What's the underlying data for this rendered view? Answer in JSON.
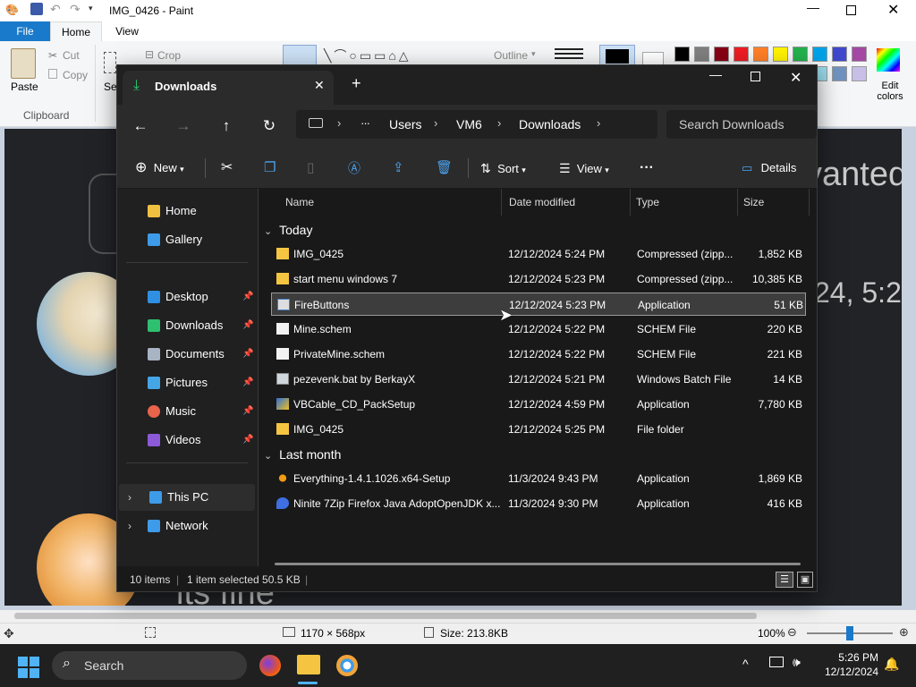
{
  "paint": {
    "title": "IMG_0426 - Paint",
    "tabs": {
      "file": "File",
      "home": "Home",
      "view": "View"
    },
    "ribbon": {
      "paste": "Paste",
      "cut": "Cut",
      "copy": "Copy",
      "crop": "Crop",
      "outline": "Outline",
      "clipboard_group": "Clipboard",
      "select_partial": "Se",
      "edit_colors": "Edit colors"
    },
    "canvas_text": {
      "wanted": "vanted",
      "time": "24, 5:2",
      "bottom": "its fine"
    },
    "status": {
      "dimensions": "1170 × 568px",
      "size": "Size: 213.8KB",
      "zoom": "100%",
      "zoom_level": 0.5
    },
    "palette": [
      "#000000",
      "#7f7f7f",
      "#880015",
      "#ed1c24",
      "#ff7f27",
      "#fff200",
      "#22b14c",
      "#00a2e8",
      "#3f48cc",
      "#a349a4",
      "#ffffff",
      "#c3c3c3",
      "#b97a57",
      "#ffaec9",
      "#ffc90e",
      "#efe4b0",
      "#b5e61d",
      "#99d9ea",
      "#7092be",
      "#c8bfe7"
    ]
  },
  "explorer": {
    "tab_title": "Downloads",
    "new_tab": "+",
    "breadcrumb": [
      "Users",
      "VM6",
      "Downloads"
    ],
    "breadcrumb_more": "···",
    "search_placeholder": "Search Downloads",
    "commands": {
      "new": "New",
      "sort": "Sort",
      "view": "View",
      "more": "···",
      "details": "Details"
    },
    "sidebar": {
      "home": "Home",
      "gallery": "Gallery",
      "desktop": "Desktop",
      "downloads": "Downloads",
      "documents": "Documents",
      "pictures": "Pictures",
      "music": "Music",
      "videos": "Videos",
      "this_pc": "This PC",
      "network": "Network"
    },
    "columns": {
      "name": "Name",
      "date": "Date modified",
      "type": "Type",
      "size": "Size"
    },
    "groups": {
      "today": "Today",
      "last_month": "Last month"
    },
    "today_files": [
      {
        "name": "IMG_0425",
        "date": "12/12/2024 5:24 PM",
        "type": "Compressed (zipp...",
        "size": "1,852 KB",
        "icon": "zip-folder-icon"
      },
      {
        "name": "start menu windows 7",
        "date": "12/12/2024 5:23 PM",
        "type": "Compressed (zipp...",
        "size": "10,385 KB",
        "icon": "zip-folder-icon"
      },
      {
        "name": "FireButtons",
        "date": "12/12/2024 5:23 PM",
        "type": "Application",
        "size": "51 KB",
        "icon": "application-icon"
      },
      {
        "name": "Mine.schem",
        "date": "12/12/2024 5:22 PM",
        "type": "SCHEM File",
        "size": "220 KB",
        "icon": "file-icon"
      },
      {
        "name": "PrivateMine.schem",
        "date": "12/12/2024 5:22 PM",
        "type": "SCHEM File",
        "size": "221 KB",
        "icon": "file-icon"
      },
      {
        "name": "pezevenk.bat by BerkayX",
        "date": "12/12/2024 5:21 PM",
        "type": "Windows Batch File",
        "size": "14 KB",
        "icon": "batch-file-icon"
      },
      {
        "name": "VBCable_CD_PackSetup",
        "date": "12/12/2024 4:59 PM",
        "type": "Application",
        "size": "7,780 KB",
        "icon": "setup-icon"
      },
      {
        "name": "IMG_0425",
        "date": "12/12/2024 5:25 PM",
        "type": "File folder",
        "size": "",
        "icon": "folder-icon"
      }
    ],
    "last_month_files": [
      {
        "name": "Everything-1.4.1.1026.x64-Setup",
        "date": "11/3/2024 9:43 PM",
        "type": "Application",
        "size": "1,869 KB",
        "icon": "search-app-icon"
      },
      {
        "name": "Ninite 7Zip Firefox Java AdoptOpenJDK x...",
        "date": "11/3/2024 9:30 PM",
        "type": "Application",
        "size": "416 KB",
        "icon": "ninite-icon"
      }
    ],
    "status": {
      "items": "10 items",
      "selected": "1 item selected  50.5 KB"
    }
  },
  "taskbar": {
    "search": "Search",
    "time": "5:26 PM",
    "date": "12/12/2024"
  }
}
